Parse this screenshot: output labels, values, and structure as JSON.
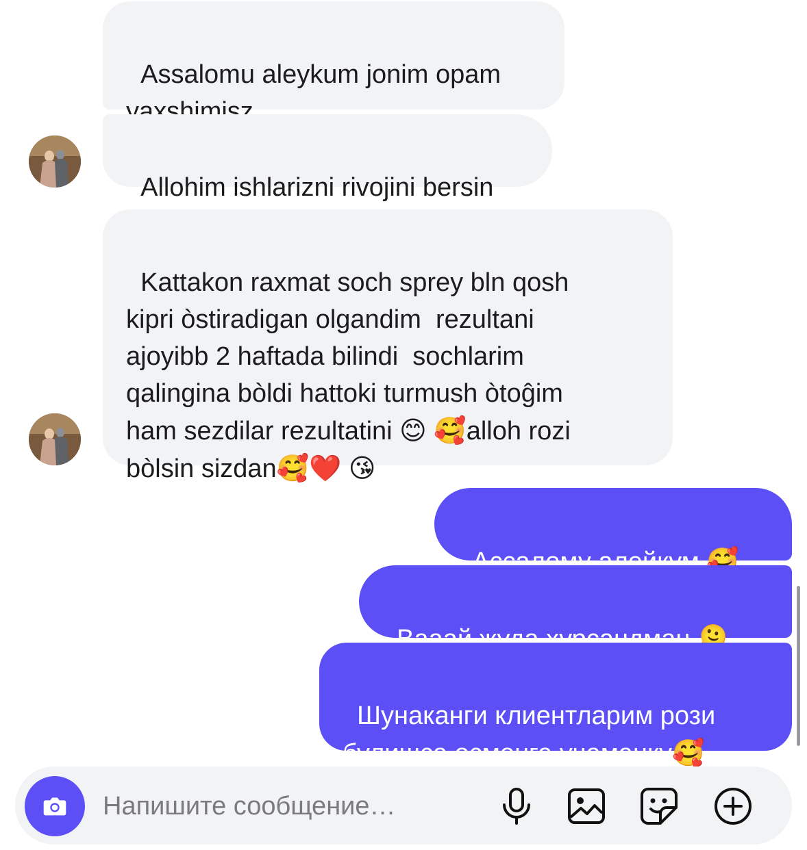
{
  "messages": [
    {
      "dir": "in",
      "text": "Assalomu aleykum jonim opam\nyaxshimisz"
    },
    {
      "dir": "in",
      "text": "Allohim ishlarizni rivojini bersin"
    },
    {
      "dir": "in",
      "text_before": "Kattakon raxmat soch sprey bln qosh\nkipri òstiradigan olgandim  rezultani\najoyibb 2 haftada bilindi  sochlarim\nqalingina bòldi hattoki turmush òtoĝim\nham sezdilar rezultatini ",
      "emoji1": "😊",
      "emoji2": "🥰",
      "text_middle": "alloh rozi\nbòlsin sizdan",
      "emoji3": "🥰",
      "emoji4": "❤️",
      "emoji5": "😘"
    },
    {
      "dir": "out",
      "text": "Ассалому алейкум ",
      "emoji": "🥰"
    },
    {
      "dir": "out",
      "text": "Вааай жуда хурсандман ",
      "emoji": "🫠"
    },
    {
      "dir": "out",
      "text": "Шунаканги клиентларим рози\nбулишса осмонга учаманку",
      "emoji": "🥰"
    }
  ],
  "composer": {
    "placeholder": "Напишите сообщение…"
  },
  "colors": {
    "outgoing_bubble": "#5b4ff5",
    "incoming_bubble": "#f2f3f5"
  }
}
